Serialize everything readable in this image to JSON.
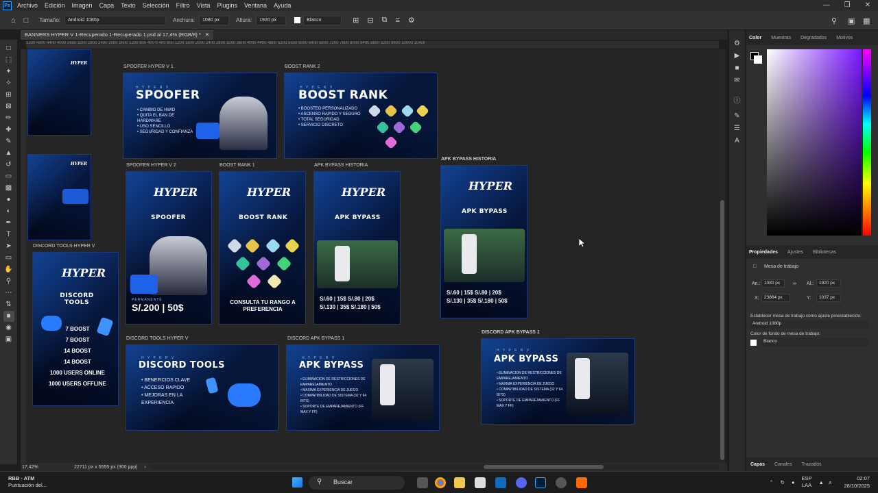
{
  "menubar": {
    "app_icon": "Ps",
    "items": [
      "Archivo",
      "Edición",
      "Imagen",
      "Capa",
      "Texto",
      "Selección",
      "Filtro",
      "Vista",
      "Plugins",
      "Ventana",
      "Ayuda"
    ]
  },
  "options": {
    "size_label": "Tamaño:",
    "size_value": "Android 1080p",
    "width_label": "Anchura:",
    "width_value": "1080 px",
    "height_label": "Altura:",
    "height_value": "1920 px",
    "fill_value": "Blanco"
  },
  "document": {
    "tab_title": "BANNERS HYPER V 1-Recuperado 1-Recuperado 1.psd al 17,4% (RGB/8) *",
    "ruler_ticks": "5200 4800 4400 4000 3600 3200 2800 2400 2000 1600 1200 800 400 0 400 800 1200 1600 2000 2400 2800 3200 3600 4000 4400 4800 5200 5600 6000 6400 6800 7200 7600 8000 8400 8800 9200 9600 10000 10400"
  },
  "artboards": {
    "spoofer_v1": {
      "label": "SPOOFER HYPER V 1",
      "title": "SPOOFER",
      "small": "H Y P E R  V",
      "bullets": "• CAMBIO DE HWID\n• QUITA EL BAN DE HARDWARE\n• USO SENCILLO\n• SEGURIDAD Y CONFIANZA"
    },
    "boost_rank_2": {
      "label": "BOOST RANK 2",
      "title": "BOOST RANK",
      "small": "H Y P E R  V",
      "bullets": "• BOOSTEO PERSONALIZADO\n• ASCENSO RAPIDO Y SEGURO\n• TOTAL SEGURIDAD\n• SERVICIO DISCRETO"
    },
    "spoofer_v2": {
      "label": "SPOOFER HYPER V 2",
      "logo": "HYPER",
      "title": "SPOOFER",
      "price_tag": "PERMANENTE",
      "price": "S/.200 | 50$"
    },
    "boost_rank_1": {
      "label": "BOOST RANK 1",
      "logo": "HYPER",
      "title": "BOOST RANK",
      "footer": "CONSULTA TU RANGO A PREFERENCIA"
    },
    "apk_historia": {
      "label": "APK BYPASS HISTORIA",
      "logo": "HYPER",
      "title": "APK BYPASS",
      "prices": "S/.60 | 15$   S/.80 | 20$\nS/.130 | 35$   S/.180 | 50$"
    },
    "apk_historia_b": {
      "label": "APK BYPASS HISTORIA",
      "logo": "HYPER",
      "title": "APK BYPASS",
      "prices": "S/.60 | 15$   S/.80 | 20$\nS/.130 | 35$   S/.180 | 50$"
    },
    "discord_tools_v": {
      "label": "DISCORD TOOLS HYPER V",
      "logo": "HYPER",
      "title": "DISCORD TOOLS",
      "lines": "7 BOOST\n7 BOOST\n14 BOOST\n14 BOOST\n1000 USERS ONLINE\n1000 USERS OFFLINE"
    },
    "discord_tools_h": {
      "label": "DISCORD TOOLS HYPER V",
      "title": "DISCORD TOOLS",
      "small": "H Y P E R  V",
      "bullets": "• BENEFICIOS CLAVE\n• ACCESO RAPIDO\n• MEJORAS EN LA EXPERIENCIA"
    },
    "discord_apk_1": {
      "label": "DISCORD APK BYPASS 1",
      "title": "APK BYPASS",
      "small": "H Y P E R  V",
      "bullets": "• ELIMINACION DE RESTRICCIONES DE EMPAREJAMIENTO\n• MAXIMA EXPERIENCIA DE JUEGO\n• COMPATIBILIDAD DE SISTEMA (32 Y 64 BITS)\n• SOPORTE DE EMPAREJAMIENTO (FF MAX Y FF)"
    },
    "discord_apk_1b": {
      "label": "DISCORD APK BYPASS 1",
      "title": "APK BYPASS",
      "small": "H Y P E R  V",
      "bullets": "• ELIMINACION DE RESTRICCIONES DE EMPAREJAMIENTO\n• MAXIMA EXPERIENCIA DE JUEGO\n• COMPATIBILIDAD DE SISTEMA (32 Y 64 BITS)\n• SOPORTE DE EMPAREJAMIENTO (FF MAX Y FF)"
    },
    "thumb_logo": "HYPER"
  },
  "status": {
    "zoom": "17,42%",
    "doc_size": "22711 px x 5555 px (300 ppp)"
  },
  "color_panel": {
    "tabs": [
      "Color",
      "Muestras",
      "Degradados",
      "Motivos"
    ]
  },
  "properties": {
    "tabs": [
      "Propiedades",
      "Ajustes",
      "Bibliotecas"
    ],
    "type": "Mesa de trabajo",
    "an_label": "An.:",
    "an_value": "1080 px",
    "al_label": "Al.:",
    "al_value": "1920 px",
    "x_label": "X:",
    "x_value": "23864 px",
    "y_label": "Y:",
    "y_value": "1037 px",
    "preset_label": "Establecer mesa de trabajo como ajuste preestablecido:",
    "preset_value": "Android 1080p",
    "bg_label": "Color de fondo de mesa de trabajo:",
    "bg_value": "Blanco"
  },
  "layers_tabs": [
    "Capas",
    "Canales",
    "Trazados"
  ],
  "taskbar": {
    "weather_title": "RBB - ATM",
    "weather_sub": "Puntuación del...",
    "search": "Buscar",
    "lang": "ESP",
    "lang_sub": "LAA",
    "time": "02:07",
    "date": "28/10/2025"
  }
}
